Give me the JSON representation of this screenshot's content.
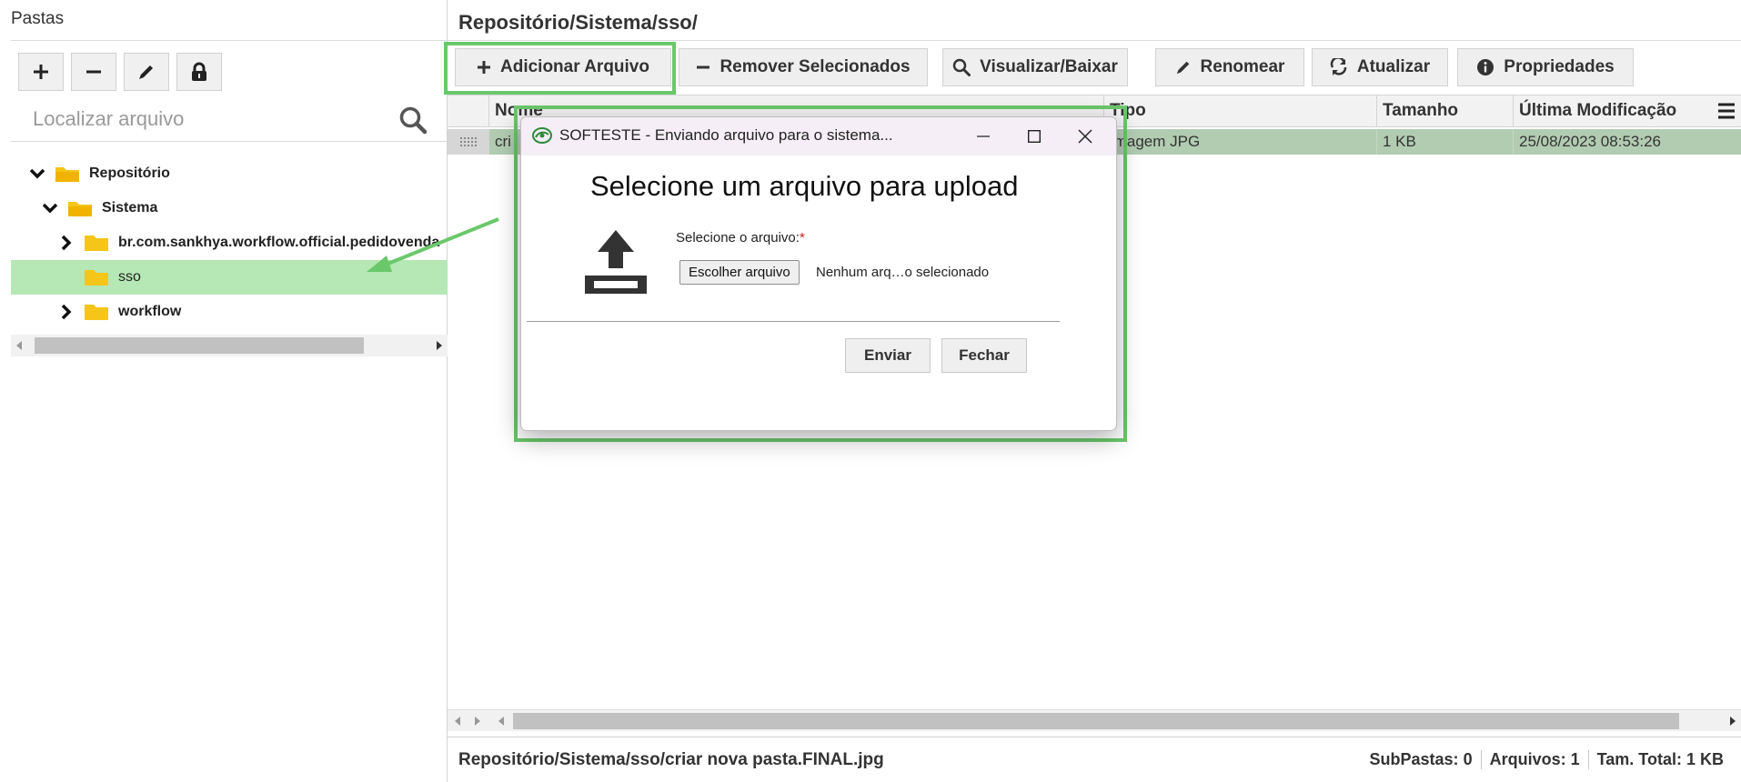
{
  "left_panel": {
    "title": "Pastas",
    "toolbar": [
      {
        "name": "add-folder-button",
        "icon": "plus-icon"
      },
      {
        "name": "remove-folder-button",
        "icon": "minus-icon"
      },
      {
        "name": "rename-folder-button",
        "icon": "pencil-icon"
      },
      {
        "name": "lock-folder-button",
        "icon": "lock-icon"
      }
    ],
    "search": {
      "placeholder": "Localizar arquivo",
      "value": ""
    },
    "tree": [
      {
        "label": "Repositório",
        "expanded": true,
        "level": 0
      },
      {
        "label": "Sistema",
        "expanded": true,
        "level": 1
      },
      {
        "label": "br.com.sankhya.workflow.official.pedidovenda",
        "expanded": false,
        "level": 2
      },
      {
        "label": "sso",
        "selected": true,
        "level": 2
      },
      {
        "label": "workflow",
        "expanded": false,
        "level": 2
      }
    ]
  },
  "main": {
    "path_title": "Repositório/Sistema/sso/",
    "actions": [
      {
        "label": "Adicionar Arquivo",
        "icon": "plus-icon"
      },
      {
        "label": "Remover Selecionados",
        "icon": "minus-icon"
      },
      {
        "label": "Visualizar/Baixar",
        "icon": "search-icon"
      },
      {
        "label": "Renomear",
        "icon": "pencil-icon"
      },
      {
        "label": "Atualizar",
        "icon": "refresh-icon"
      },
      {
        "label": "Propriedades",
        "icon": "info-icon"
      }
    ],
    "grid": {
      "columns": [
        "Nome",
        "Tipo",
        "Tamanho",
        "Última Modificação"
      ],
      "rows": [
        {
          "name": "cri",
          "type": "Imagem JPG",
          "size": "1 KB",
          "modified": "25/08/2023 08:53:26"
        }
      ]
    },
    "status": {
      "path": "Repositório/Sistema/sso/criar nova pasta.FINAL.jpg",
      "subfolders_label": "SubPastas:",
      "subfolders": "0",
      "files_label": "Arquivos:",
      "files": "1",
      "total_label": "Tam. Total:",
      "total": "1 KB"
    }
  },
  "dialog": {
    "title": "SOFTESTE - Enviando arquivo para o sistema...",
    "heading": "Selecione um arquivo para upload",
    "field_label": "Selecione o arquivo:",
    "required_mark": "*",
    "choose_button": "Escolher arquivo",
    "file_status": "Nenhum arq…o selecionado",
    "send_button": "Enviar",
    "close_button": "Fechar"
  },
  "colors": {
    "highlight": "#6ac86a",
    "selected_tree": "#b5e8b5",
    "selected_row": "#b2ccb2",
    "folder": "#f5c518"
  }
}
